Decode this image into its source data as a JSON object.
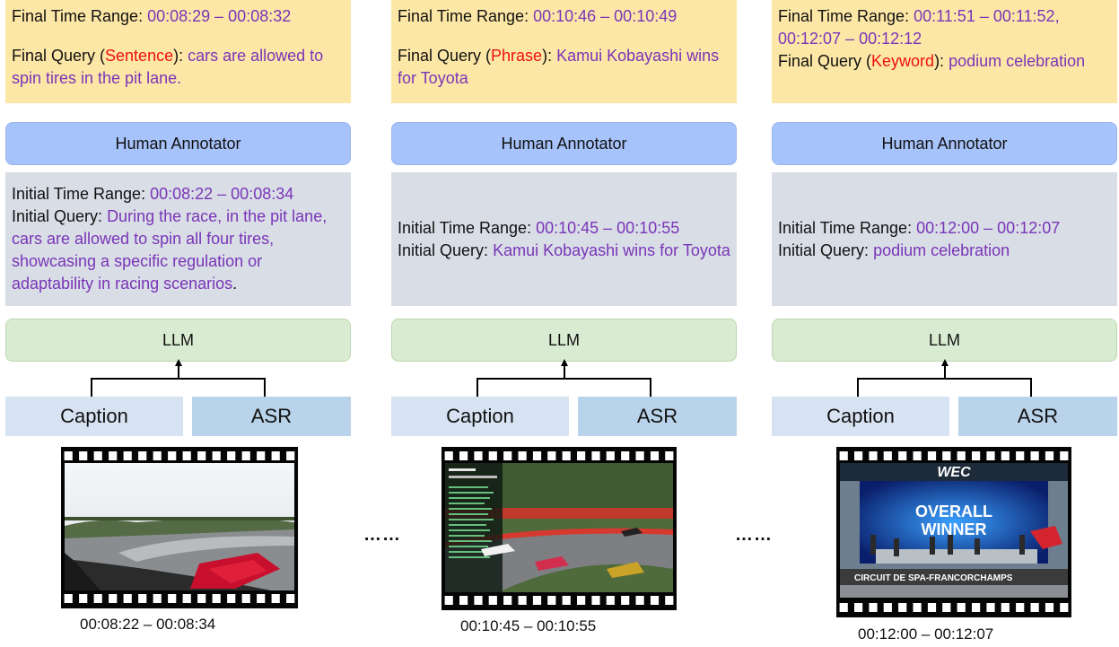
{
  "panels": [
    {
      "final_time_label": "Final Time Range:",
      "final_time_value": "00:08:29 – 00:08:32",
      "final_query_label": "Final Query (",
      "final_query_type": "Sentence",
      "final_query_close": "):",
      "final_query_text": " cars are allowed to spin tires in the pit lane.",
      "human_label": "Human Annotator",
      "initial_time_label": "Initial Time Range:",
      "initial_time_value": "00:08:22 – 00:08:34",
      "initial_query_label": "Initial Query:",
      "initial_query_text": "During the race, in the pit lane, cars are allowed to spin all four tires, showcasing a specific regulation or adaptability in racing scenarios",
      "initial_query_end": ".",
      "llm_label": "LLM",
      "caption_label": "Caption",
      "asr_label": "ASR",
      "clip_time": "00:08:22 – 00:08:34"
    },
    {
      "final_time_label": "Final Time Range:",
      "final_time_value": "00:10:46 – 00:10:49",
      "final_query_label": "Final Query (",
      "final_query_type": "Phrase",
      "final_query_close": "):",
      "final_query_text": " Kamui Kobayashi wins for Toyota",
      "human_label": "Human Annotator",
      "initial_time_label": "Initial Time Range:",
      "initial_time_value": "00:10:45 – 00:10:55",
      "initial_query_label": "Initial Query:",
      "initial_query_text": "Kamui Kobayashi wins for Toyota",
      "initial_query_end": "",
      "llm_label": "LLM",
      "caption_label": "Caption",
      "asr_label": "ASR",
      "clip_time": "00:10:45 – 00:10:55"
    },
    {
      "final_time_label": "Final Time Range:",
      "final_time_value": "00:11:51 – 00:11:52, 00:12:07 – 00:12:12",
      "final_query_label": "Final Query (",
      "final_query_type": "Keyword",
      "final_query_close": "):",
      "final_query_text": " podium celebration",
      "human_label": "Human Annotator",
      "initial_time_label": "Initial Time Range:",
      "initial_time_value": "00:12:00 – 00:12:07",
      "initial_query_label": "Initial Query:",
      "initial_query_text": "podium celebration",
      "initial_query_end": "",
      "llm_label": "LLM",
      "caption_label": "Caption",
      "asr_label": "ASR",
      "clip_time": "00:12:00 – 00:12:07"
    }
  ],
  "ellipsis": "……",
  "frame_text": {
    "wec_logo": "WEC",
    "overall_winner_line1": "OVERALL",
    "overall_winner_line2": "WINNER",
    "circuit": "CIRCUIT DE SPA-FRANCORCHAMPS"
  },
  "colors": {
    "final_bg": "#fde7a6",
    "human_bg": "#a7c3fb",
    "initial_bg": "#d8dde6",
    "llm_bg": "#d9ecd2",
    "caption_bg": "#d7e3f2",
    "asr_bg": "#b9d3ea",
    "query_purple": "#7a35b8",
    "query_type_red": "#ee1111"
  }
}
